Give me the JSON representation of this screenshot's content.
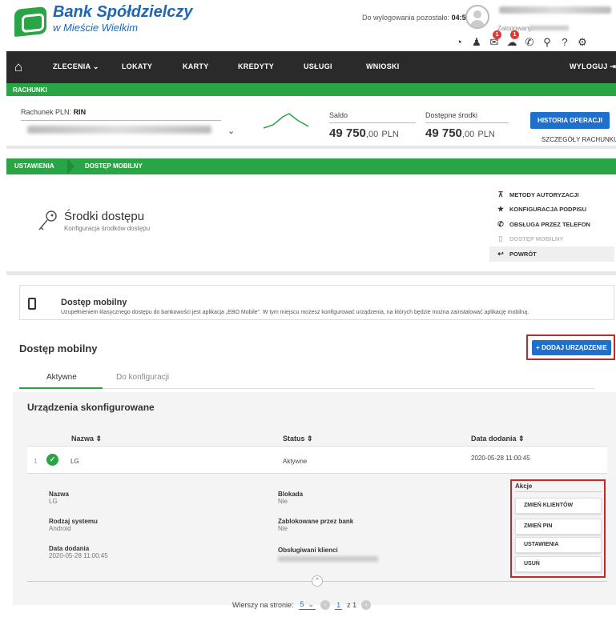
{
  "header": {
    "brand_line1": "Bank Spółdzielczy",
    "brand_line2": "w Mieście Wielkim",
    "logout_label": "Do wylogowania pozostało:",
    "logout_timer": "04:59",
    "logged_label": "Zalogowany:",
    "notification_badges": [
      "1",
      "1"
    ],
    "icons": [
      "speedometer-icon",
      "user-icon",
      "mail-icon",
      "chat-icon",
      "phone-icon",
      "location-icon",
      "help-icon",
      "settings-icon"
    ]
  },
  "nav": {
    "items": [
      "ZLECENIA",
      "LOKATY",
      "KARTY",
      "KREDYTY",
      "USŁUGI",
      "WNIOSKI"
    ],
    "logout": "WYLOGUJ"
  },
  "accounts": {
    "section_label": "RACHUNKI",
    "account_label": "Rachunek PLN:",
    "account_name": "RIN",
    "saldo_label": "Saldo",
    "saldo_int": "49 750",
    "saldo_dec": ",00",
    "saldo_cur": "PLN",
    "available_label": "Dostępne środki",
    "available_int": "49 750",
    "available_dec": ",00",
    "available_cur": "PLN",
    "history_button": "HISTORIA OPERACJI",
    "details_link": "SZCZEGÓŁY RACHUNKU"
  },
  "breadcrumb": [
    "USTAWIENIA",
    "DOSTĘP MOBILNY"
  ],
  "settings": {
    "title": "Środki dostępu",
    "subtitle": "Konfiguracja środków dostępu",
    "menu": [
      {
        "label": "METODY AUTORYZACJI",
        "icon": "sitemap-icon"
      },
      {
        "label": "KONFIGURACJA PODPISU",
        "icon": "star-icon"
      },
      {
        "label": "OBSŁUGA PRZEZ TELEFON",
        "icon": "phone-icon"
      },
      {
        "label": "DOSTĘP MOBILNY",
        "icon": "mobile-icon"
      },
      {
        "label": "POWRÓT",
        "icon": "back-icon"
      }
    ]
  },
  "mobile_info": {
    "title": "Dostęp mobilny",
    "text": "Uzupełnieniem klasycznego dostępu do bankowości jest aplikacja „EBO Mobile\". W tym miejscu możesz konfigurować urządzenia, na których będzie można zainstalować aplikację mobilną."
  },
  "section": {
    "title": "Dostęp mobilny",
    "add_button": "DODAJ URZĄDZENIE",
    "tabs": [
      "Aktywne",
      "Do konfiguracji"
    ]
  },
  "devices": {
    "title": "Urządzenia skonfigurowane",
    "columns": [
      "Nazwa",
      "Status",
      "Data dodania"
    ],
    "rows": [
      {
        "num": "1",
        "name": "LG",
        "status": "Aktywne",
        "date": "2020-05-28 11:00:45"
      }
    ],
    "detail": {
      "name_label": "Nazwa",
      "name_value": "LG",
      "system_label": "Rodzaj systemu",
      "system_value": "Android",
      "date_label": "Data dodania",
      "date_value": "2020-05-28 11:00:45",
      "lock_label": "Blokada",
      "lock_value": "Nie",
      "bank_lock_label": "Zablokowane przez bank",
      "bank_lock_value": "Nie",
      "clients_label": "Obsługiwani klienci"
    },
    "actions_title": "Akcje",
    "actions": [
      "ZMIEŃ KLIENTÓW",
      "ZMIEŃ PIN",
      "USTAWIENIA",
      "USUŃ"
    ]
  },
  "pager": {
    "rows_label": "Wierszy na stronie:",
    "rows_value": "5",
    "current_page": "1",
    "of_label": "z 1"
  },
  "colors": {
    "green": "#2aa545",
    "blue": "#1f6fcc",
    "dark_nav": "#2a2a2a",
    "highlight_red": "#c62828"
  }
}
